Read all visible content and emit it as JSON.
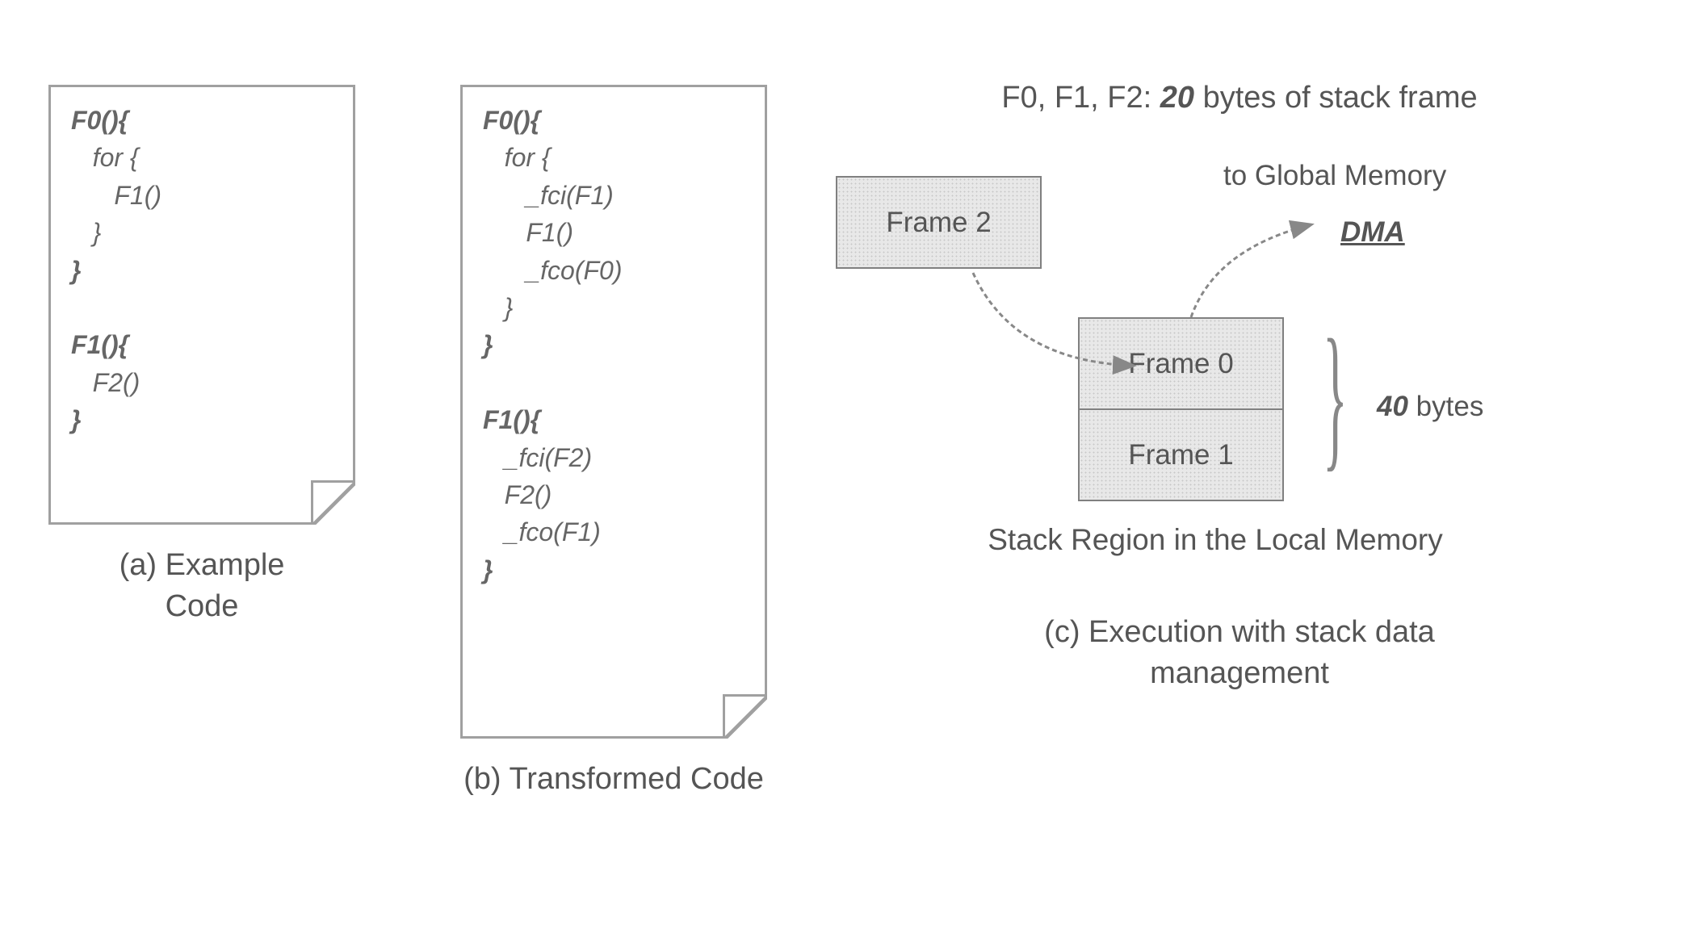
{
  "panelA": {
    "caption": "(a) Example\nCode",
    "lines": [
      {
        "text": "F0(){",
        "indent": 0,
        "cls": "bold-i"
      },
      {
        "text": "for {",
        "indent": 1,
        "cls": "italic"
      },
      {
        "text": "F1()",
        "indent": 2,
        "cls": "italic"
      },
      {
        "text": "}",
        "indent": 1,
        "cls": "italic"
      },
      {
        "text": "}",
        "indent": 0,
        "cls": "bold-i"
      },
      {
        "text": "",
        "indent": 0,
        "cls": ""
      },
      {
        "text": "F1(){",
        "indent": 0,
        "cls": "bold-i"
      },
      {
        "text": "F2()",
        "indent": 1,
        "cls": "italic"
      },
      {
        "text": "}",
        "indent": 0,
        "cls": "bold-i"
      }
    ]
  },
  "panelB": {
    "caption": "(b) Transformed Code",
    "lines": [
      {
        "text": "F0(){",
        "indent": 0,
        "cls": "bold-i"
      },
      {
        "text": "for {",
        "indent": 1,
        "cls": "italic"
      },
      {
        "text": "_fci(F1)",
        "indent": 2,
        "cls": "italic"
      },
      {
        "text": "F1()",
        "indent": 2,
        "cls": "italic"
      },
      {
        "text": "_fco(F0)",
        "indent": 2,
        "cls": "italic"
      },
      {
        "text": "}",
        "indent": 1,
        "cls": "italic"
      },
      {
        "text": "}",
        "indent": 0,
        "cls": "bold-i"
      },
      {
        "text": "",
        "indent": 0,
        "cls": ""
      },
      {
        "text": "F1(){",
        "indent": 0,
        "cls": "bold-i"
      },
      {
        "text": "_fci(F2)",
        "indent": 1,
        "cls": "italic"
      },
      {
        "text": "F2()",
        "indent": 1,
        "cls": "italic"
      },
      {
        "text": "_fco(F1)",
        "indent": 1,
        "cls": "italic"
      },
      {
        "text": "}",
        "indent": 0,
        "cls": "bold-i"
      }
    ]
  },
  "panelC": {
    "topline_prefix": "F0, F1, F2: ",
    "topline_bold": "20",
    "topline_suffix": " bytes of stack frame",
    "global_mem_label": "to Global Memory",
    "dma_label": "DMA",
    "frame2_label": "Frame 2",
    "frame0_label": "Frame 0",
    "frame1_label": "Frame 1",
    "bytes_bold": "40",
    "bytes_suffix": " bytes",
    "stack_label": "Stack Region in the Local Memory",
    "caption": "(c) Execution with stack data\nmanagement"
  }
}
